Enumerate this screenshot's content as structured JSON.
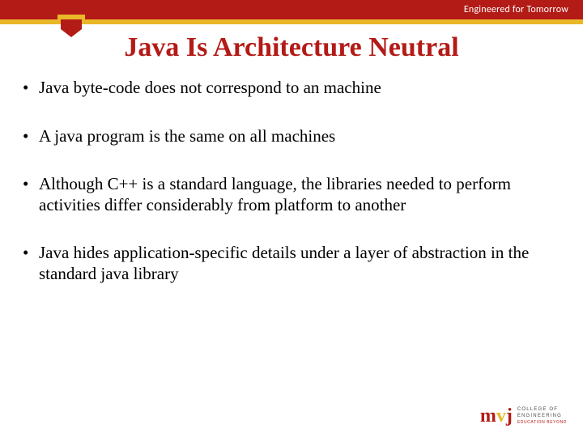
{
  "header": {
    "tagline": "Engineered for Tomorrow"
  },
  "title": "Java Is Architecture Neutral",
  "bullets": [
    "Java byte-code does not correspond to an machine",
    "A java program is the same on all machines",
    "Although C++ is a standard language, the libraries needed to perform activities differ considerably from platform to another",
    "Java hides application-specific details under a layer of abstraction in the standard java library"
  ],
  "logo": {
    "mark_m1": "m",
    "mark_v": "v",
    "mark_j": "j",
    "line1": "COLLEGE OF",
    "line2": "ENGINEERING",
    "sub": "EDUCATION BEYOND"
  }
}
